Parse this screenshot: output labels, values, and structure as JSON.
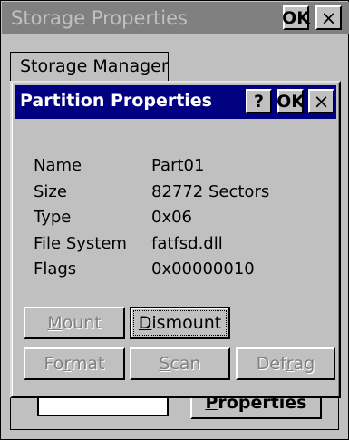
{
  "outer_window": {
    "title": "Storage Properties",
    "ok_label": "OK",
    "close_label": "×"
  },
  "tab": {
    "label": "Storage Manager"
  },
  "background": {
    "properties_button": {
      "pre": "",
      "accel": "P",
      "post": "roperties"
    }
  },
  "dialog": {
    "title": "Partition Properties",
    "help_label": "?",
    "ok_label": "OK",
    "close_label": "×",
    "properties": [
      {
        "label": "Name",
        "value": "Part01"
      },
      {
        "label": "Size",
        "value": "82772 Sectors"
      },
      {
        "label": "Type",
        "value": "0x06"
      },
      {
        "label": "File System",
        "value": "fatfsd.dll"
      },
      {
        "label": "Flags",
        "value": "0x00000010"
      }
    ],
    "buttons": {
      "mount": {
        "pre": "",
        "accel": "M",
        "post": "ount",
        "enabled": false
      },
      "dismount": {
        "pre": "",
        "accel": "D",
        "post": "ismount",
        "enabled": true
      },
      "format": {
        "pre": "Fo",
        "accel": "r",
        "post": "mat",
        "enabled": false
      },
      "scan": {
        "pre": "",
        "accel": "S",
        "post": "can",
        "enabled": false
      },
      "defrag": {
        "pre": "Def",
        "accel": "r",
        "post": "ag",
        "enabled": false
      }
    }
  }
}
